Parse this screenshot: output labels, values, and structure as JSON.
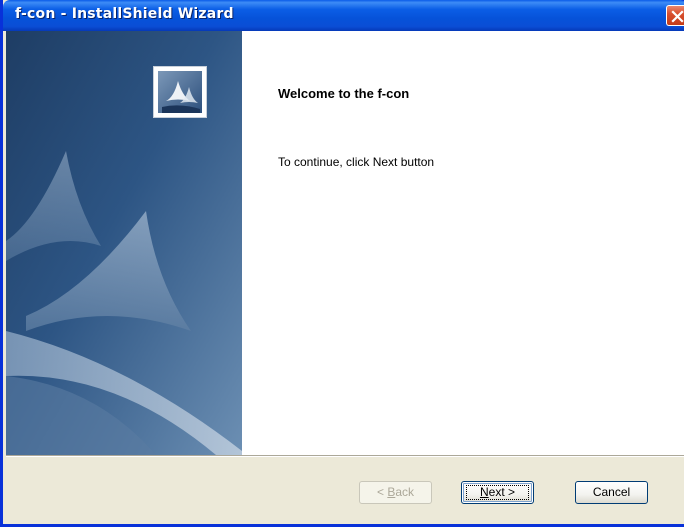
{
  "window": {
    "title": "f-con - InstallShield Wizard"
  },
  "content": {
    "heading": "Welcome to the f-con",
    "message": "To continue, click Next button"
  },
  "buttons": {
    "back_prefix": "< ",
    "back_mnemonic": "B",
    "back_rest": "ack",
    "next_mnemonic": "N",
    "next_rest": "ext >",
    "cancel": "Cancel"
  },
  "icons": {
    "close": "close-icon",
    "logo": "installshield-logo-icon"
  },
  "colors": {
    "titlebar": "#0a4ed6",
    "close_button": "#d9502f",
    "dialog_background": "#ece9d8",
    "sidebar": "#2c4f7c"
  }
}
